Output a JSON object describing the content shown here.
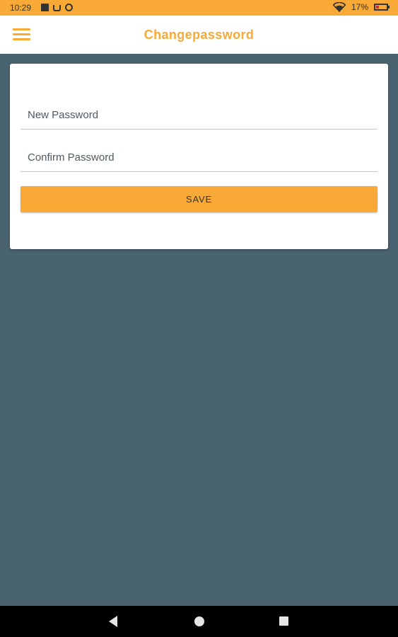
{
  "status_bar": {
    "time": "10:29",
    "battery": "17%",
    "notification_icons": [
      "notification-square-icon",
      "cast-icon",
      "sync-icon"
    ],
    "wifi_icon": "wifi-icon",
    "battery_icon": "battery-low-icon"
  },
  "app_bar": {
    "title": "Changepassword",
    "menu_icon": "hamburger-menu-icon"
  },
  "form": {
    "new_password": {
      "placeholder": "New Password",
      "value": ""
    },
    "confirm_password": {
      "placeholder": "Confirm Password",
      "value": ""
    },
    "save_label": "SAVE"
  },
  "nav_bar": {
    "icons": [
      "back-icon",
      "home-icon",
      "recents-icon"
    ]
  },
  "colors": {
    "accent": "#f9a935",
    "background": "#4a6370",
    "card": "#ffffff",
    "nav_bar": "#000000"
  }
}
